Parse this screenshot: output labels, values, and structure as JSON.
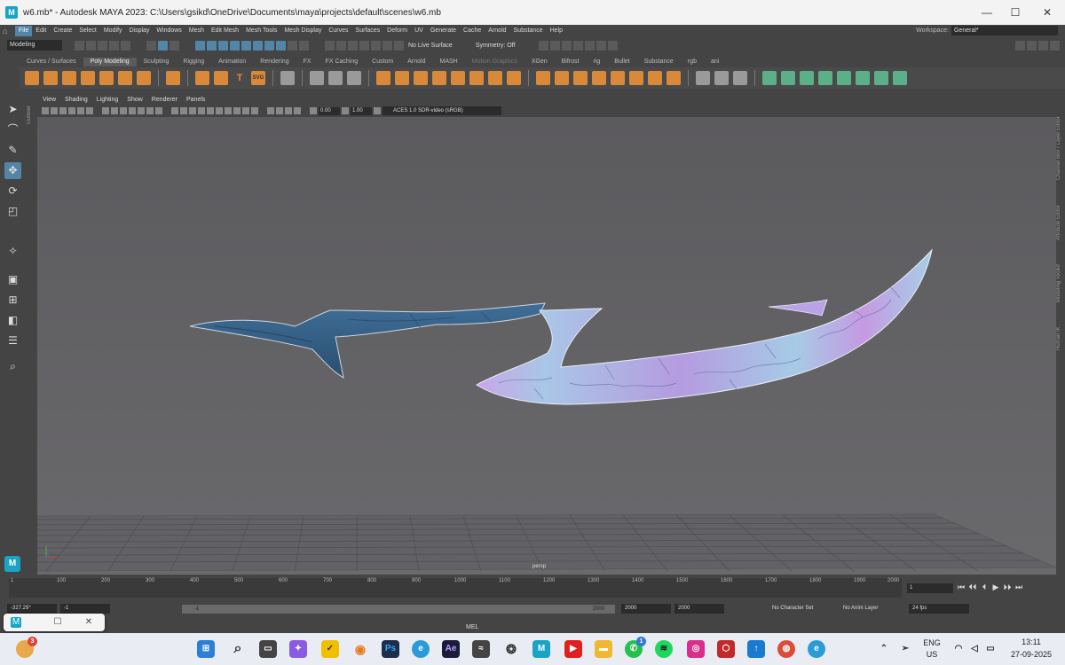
{
  "titlebar": {
    "app_icon": "M",
    "title": "w6.mb* - Autodesk MAYA 2023: C:\\Users\\gsikd\\OneDrive\\Documents\\maya\\projects\\default\\scenes\\w6.mb",
    "minimize": "—",
    "maximize": "☐",
    "close": "✕"
  },
  "menubar": {
    "items": [
      "File",
      "Edit",
      "Create",
      "Select",
      "Modify",
      "Display",
      "Windows",
      "Mesh",
      "Edit Mesh",
      "Mesh Tools",
      "Mesh Display",
      "Curves",
      "Surfaces",
      "Deform",
      "UV",
      "Generate",
      "Cache",
      "Arnold",
      "Substance",
      "Help"
    ],
    "active": "File",
    "workspace_label": "Workspace:",
    "workspace_value": "General*"
  },
  "statusline": {
    "mode": "Modeling",
    "live_surface": "No Live Surface",
    "symmetry": "Symmetry: Off"
  },
  "shelf_tabs": [
    "Curves / Surfaces",
    "Poly Modeling",
    "Sculpting",
    "Rigging",
    "Animation",
    "Rendering",
    "FX",
    "FX Caching",
    "Custom",
    "Arnold",
    "MASH",
    "Motion Graphics",
    "XGen",
    "Bifrost",
    "rig",
    "Bullet",
    "Substance",
    "rgb",
    "ani"
  ],
  "shelf_active": "Poly Modeling",
  "shelf_text_icons": {
    "text_tool": "T",
    "svg_tool": "SVG"
  },
  "panel": {
    "menus": [
      "View",
      "Shading",
      "Lighting",
      "Show",
      "Renderer",
      "Panels"
    ],
    "exposure": "0.00",
    "gamma": "1.00",
    "color_space": "ACES 1.0 SDR-video (sRGB)",
    "camera": "persp",
    "outliner_label": "Outliner"
  },
  "right_labels": [
    "Channel Box / Layer Editor",
    "Attribute Editor",
    "Modeling Toolkit",
    "Human IK"
  ],
  "timeslider": {
    "ticks": [
      "1",
      "100",
      "200",
      "300",
      "400",
      "500",
      "600",
      "700",
      "800",
      "900",
      "1000",
      "1100",
      "1200",
      "1300",
      "1400",
      "1500",
      "1600",
      "1700",
      "1800",
      "1900",
      "2000"
    ],
    "current_frame": "1",
    "play_glyphs": [
      "⏮",
      "⏴⏴",
      "⏴",
      "▶",
      "⏵⏵",
      "⏭"
    ]
  },
  "rangeslider": {
    "start": "-327.29°",
    "range_start": "-1",
    "inner_start": "-1",
    "inner_end": "2000",
    "end": "2000",
    "anim_end": "2000",
    "char_set": "No Character Set",
    "anim_layer": "No Anim Layer",
    "fps": "24 fps"
  },
  "mel": {
    "label": "MEL"
  },
  "taskbar": {
    "badge_first": "3",
    "badge_whatsapp": "1",
    "lang_top": "ENG",
    "lang_bottom": "US",
    "time": "13:11",
    "date": "27-09-2025",
    "photoshop": "Ps",
    "after_effects": "Ae",
    "maya": "M"
  },
  "colors": {
    "maya_blue": "#19a4c6",
    "highlight": "#5285a6",
    "viewport": "#5d5c5e",
    "blade_blue": "#3c6a92",
    "blade_light": "#a9cde6",
    "blade_purple": "#b68fe0"
  }
}
